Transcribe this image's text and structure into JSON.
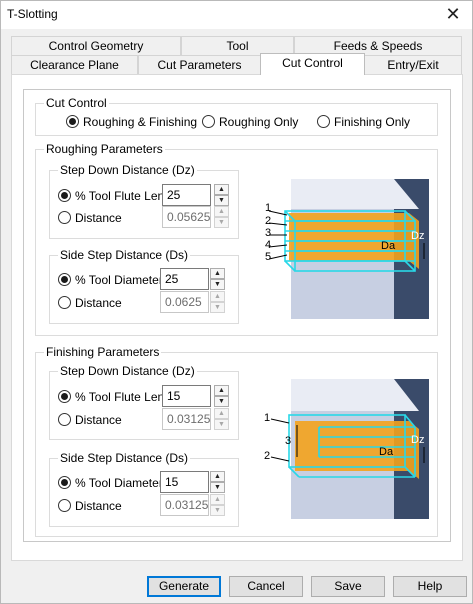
{
  "window": {
    "title": "T-Slotting",
    "close_glyph": "✕"
  },
  "tabs_row1": [
    "Control Geometry",
    "Tool",
    "Feeds & Speeds"
  ],
  "tabs_row2": [
    "Clearance Plane",
    "Cut Parameters",
    "Cut Control",
    "Entry/Exit"
  ],
  "active_tab": "Cut Control",
  "cut_control": {
    "legend": "Cut Control",
    "options": [
      "Roughing & Finishing",
      "Roughing Only",
      "Finishing Only"
    ],
    "selected": 0
  },
  "roughing": {
    "legend": "Roughing Parameters",
    "step_down": {
      "legend": "Step Down Distance (Dz)",
      "opt1": "% Tool Flute Len",
      "val1": "25",
      "opt2": "Distance",
      "val2": "0.05625"
    },
    "side_step": {
      "legend": "Side Step Distance (Ds)",
      "opt1": "% Tool Diameter",
      "val1": "25",
      "opt2": "Distance",
      "val2": "0.0625"
    },
    "diagram": {
      "labels": [
        "1",
        "2",
        "3",
        "4",
        "5"
      ],
      "da": "Da",
      "dz": "Dz"
    }
  },
  "finishing": {
    "legend": "Finishing Parameters",
    "step_down": {
      "legend": "Step Down Distance (Dz)",
      "opt1": "% Tool Flute Len",
      "val1": "15",
      "opt2": "Distance",
      "val2": "0.03125"
    },
    "side_step": {
      "legend": "Side Step Distance (Ds)",
      "opt1": "% Tool Diameter",
      "val1": "15",
      "opt2": "Distance",
      "val2": "0.03125"
    },
    "diagram": {
      "labels": [
        "1",
        "2",
        "3"
      ],
      "da": "Da",
      "dz": "Dz"
    }
  },
  "buttons": {
    "generate": "Generate",
    "cancel": "Cancel",
    "save": "Save",
    "help": "Help"
  },
  "spin_up": "▲",
  "spin_down": "▼",
  "colors": {
    "accent": "#0078d7",
    "cyan": "#29d8e8",
    "orange": "#f0a020"
  }
}
